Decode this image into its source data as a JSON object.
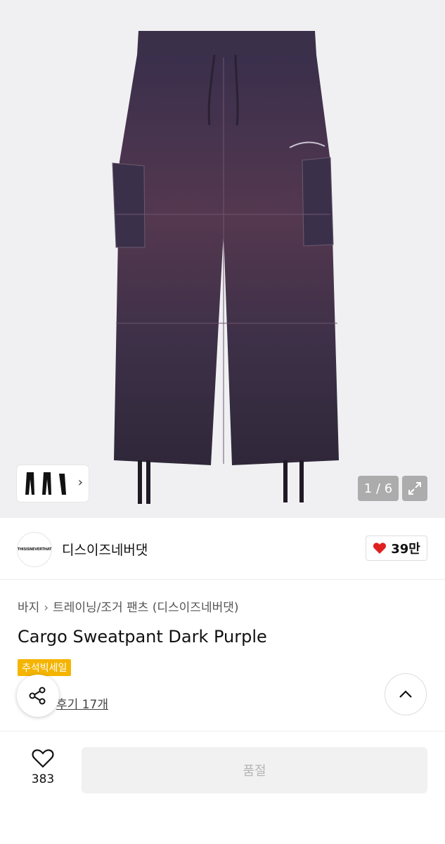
{
  "gallery": {
    "counter": "1 / 6",
    "colors": {
      "background": "#f0f0f2",
      "garment": "#3b2f4a"
    }
  },
  "brand": {
    "logo_text": "THISISNEVERTHAT",
    "name": "디스이즈네버댓",
    "like_count": "39만",
    "heart_color": "#e02020"
  },
  "product": {
    "breadcrumb": [
      "바지",
      "트레이닝/조거 팬츠 (디스이즈네버댓)"
    ],
    "title": "Cargo Sweatpant Dark Purple",
    "badge": "추석빅세일",
    "badge_color": "#f4b400",
    "review_link": "후기 17개"
  },
  "bottom": {
    "wish_count": "383",
    "action_label": "품절"
  }
}
